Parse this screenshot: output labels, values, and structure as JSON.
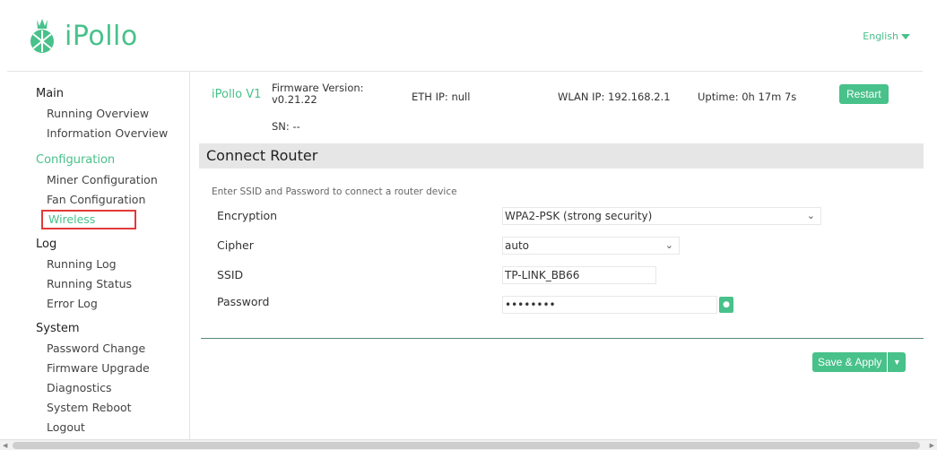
{
  "header": {
    "logo_text": "iPollo",
    "language": "English",
    "brand_color": "#48c18a"
  },
  "sidebar": {
    "groups": [
      {
        "title": "Main",
        "items": [
          "Running Overview",
          "Information Overview"
        ]
      },
      {
        "title": "Configuration",
        "items": [
          "Miner Configuration",
          "Fan Configuration",
          "Wireless"
        ]
      },
      {
        "title": "Log",
        "items": [
          "Running Log",
          "Running Status",
          "Error Log"
        ]
      },
      {
        "title": "System",
        "items": [
          "Password Change",
          "Firmware Upgrade",
          "Diagnostics",
          "System Reboot",
          "Logout"
        ]
      }
    ],
    "selected_item": "Wireless",
    "selected_outline_color": "#e23a3a"
  },
  "infobar": {
    "model": "iPollo V1",
    "firmware_label": "Firmware Version:",
    "firmware_value": "v0.21.22",
    "sn": "SN: --",
    "eth_ip": "ETH IP: null",
    "wlan_ip": "WLAN IP: 192.168.2.1",
    "uptime": "Uptime: 0h 17m 7s",
    "restart_label": "Restart"
  },
  "section": {
    "title": "Connect Router",
    "hint": "Enter SSID and Password to connect a router device"
  },
  "form": {
    "encryption": {
      "label": "Encryption",
      "value": "WPA2-PSK (strong security)"
    },
    "cipher": {
      "label": "Cipher",
      "value": "auto"
    },
    "ssid": {
      "label": "SSID",
      "value": "TP-LINK_BB66"
    },
    "password": {
      "label": "Password",
      "value": "••••••••"
    }
  },
  "actions": {
    "save_apply_label": "Save & Apply"
  }
}
